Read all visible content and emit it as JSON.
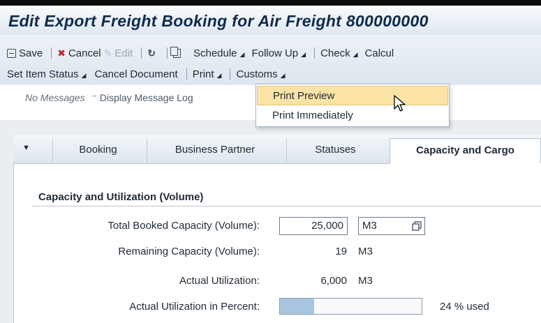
{
  "header": {
    "title": "Edit Export Freight Booking for Air Freight 800000000"
  },
  "toolbar": {
    "save": "Save",
    "cancel": "Cancel",
    "edit": "Edit",
    "schedule": "Schedule",
    "follow_up": "Follow Up",
    "check": "Check",
    "calculate": "Calcul",
    "set_item_status": "Set Item Status",
    "cancel_document": "Cancel Document",
    "print": "Print",
    "customs": "Customs"
  },
  "messages": {
    "status": "No Messages",
    "link": "Display Message Log"
  },
  "print_menu": {
    "items": [
      "Print Preview",
      "Print Immediately"
    ],
    "highlighted": "Print Preview"
  },
  "tabs": [
    {
      "label": "Booking",
      "active": false
    },
    {
      "label": "Business Partner",
      "active": false
    },
    {
      "label": "Statuses",
      "active": false
    },
    {
      "label": "Capacity and Cargo",
      "active": true
    }
  ],
  "capacity": {
    "section_title": "Capacity and Utilization (Volume)",
    "total_booked_label": "Total Booked Capacity (Volume):",
    "total_booked_value": "25,000",
    "total_booked_unit": "M3",
    "remaining_label": "Remaining Capacity (Volume):",
    "remaining_value": "19",
    "remaining_unit": "M3",
    "actual_label": "Actual Utilization:",
    "actual_value": "6,000",
    "actual_unit": "M3",
    "percent_label": "Actual Utilization in Percent:",
    "percent_value": 24,
    "percent_text": "24 % used"
  },
  "colors": {
    "title": "#0e2a4d",
    "highlight": "#fbe3a6",
    "progress_fill": "#a9c5df",
    "cancel_icon": "#c0262e"
  }
}
